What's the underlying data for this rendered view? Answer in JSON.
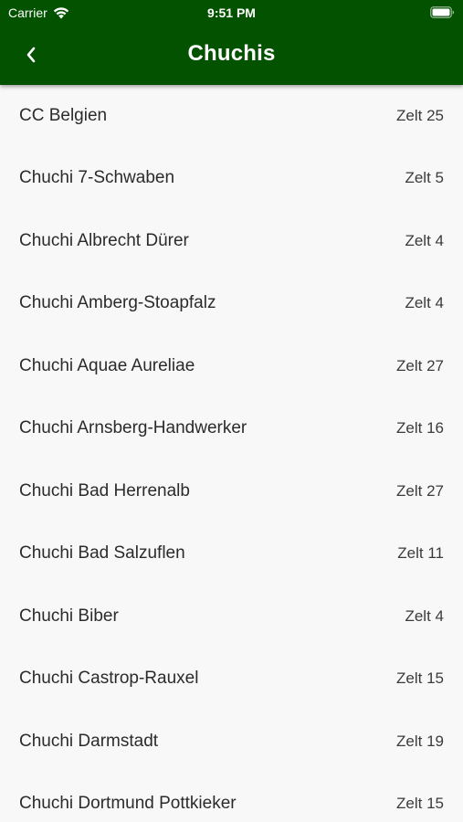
{
  "status_bar": {
    "carrier": "Carrier",
    "time": "9:51 PM",
    "icons": [
      "wifi-icon",
      "battery-icon"
    ]
  },
  "nav": {
    "title": "Chuchis",
    "back_icon": "chevron-left-icon"
  },
  "colors": {
    "header_bg": "#025200",
    "list_bg": "#f8f8f8",
    "text": "#2b2b2b"
  },
  "list": {
    "items": [
      {
        "name": "CC Belgien",
        "tent": "Zelt 25"
      },
      {
        "name": "Chuchi 7-Schwaben",
        "tent": "Zelt 5"
      },
      {
        "name": "Chuchi Albrecht Dürer",
        "tent": "Zelt 4"
      },
      {
        "name": "Chuchi Amberg-Stoapfalz",
        "tent": "Zelt 4"
      },
      {
        "name": "Chuchi Aquae Aureliae",
        "tent": "Zelt 27"
      },
      {
        "name": "Chuchi Arnsberg-Handwerker",
        "tent": "Zelt 16"
      },
      {
        "name": "Chuchi Bad Herrenalb",
        "tent": "Zelt 27"
      },
      {
        "name": "Chuchi Bad Salzuflen",
        "tent": "Zelt 11"
      },
      {
        "name": "Chuchi Biber",
        "tent": "Zelt 4"
      },
      {
        "name": "Chuchi Castrop-Rauxel",
        "tent": "Zelt 15"
      },
      {
        "name": "Chuchi Darmstadt",
        "tent": "Zelt 19"
      },
      {
        "name": "Chuchi Dortmund Pottkieker",
        "tent": "Zelt 15"
      }
    ]
  }
}
